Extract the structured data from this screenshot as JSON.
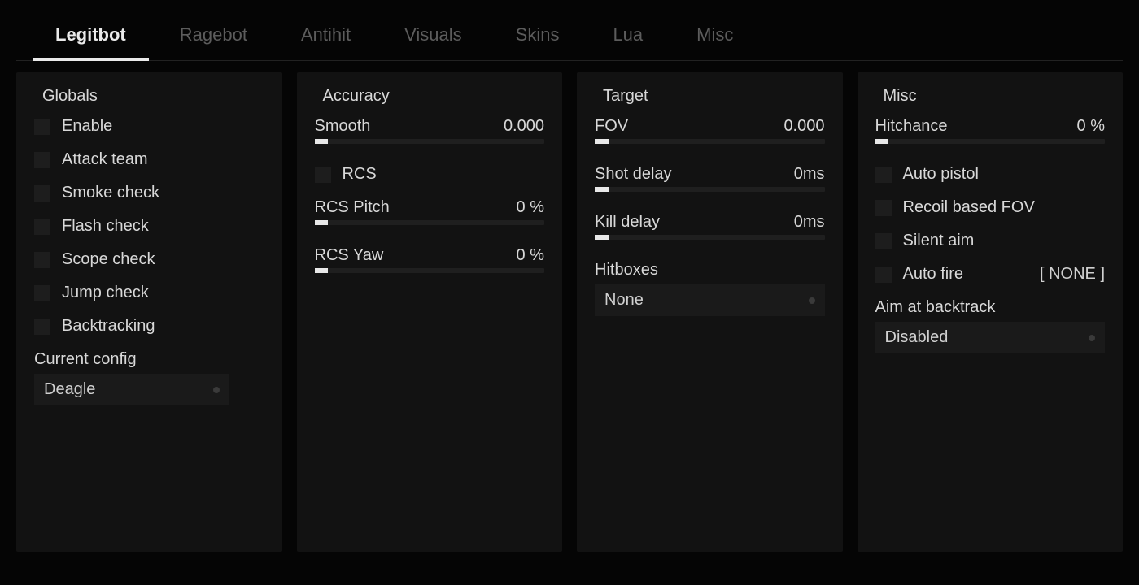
{
  "tabs": [
    {
      "label": "Legitbot",
      "active": true
    },
    {
      "label": "Ragebot",
      "active": false
    },
    {
      "label": "Antihit",
      "active": false
    },
    {
      "label": "Visuals",
      "active": false
    },
    {
      "label": "Skins",
      "active": false
    },
    {
      "label": "Lua",
      "active": false
    },
    {
      "label": "Misc",
      "active": false
    }
  ],
  "globals": {
    "title": "Globals",
    "enable": "Enable",
    "attack_team": "Attack team",
    "smoke_check": "Smoke check",
    "flash_check": "Flash check",
    "scope_check": "Scope check",
    "jump_check": "Jump check",
    "backtracking": "Backtracking",
    "config_label": "Current config",
    "config_value": "Deagle"
  },
  "accuracy": {
    "title": "Accuracy",
    "smooth_label": "Smooth",
    "smooth_value": "0.000",
    "rcs": "RCS",
    "rcs_pitch_label": "RCS Pitch",
    "rcs_pitch_value": "0 %",
    "rcs_yaw_label": "RCS Yaw",
    "rcs_yaw_value": "0 %"
  },
  "target": {
    "title": "Target",
    "fov_label": "FOV",
    "fov_value": "0.000",
    "shot_delay_label": "Shot delay",
    "shot_delay_value": "0ms",
    "kill_delay_label": "Kill delay",
    "kill_delay_value": "0ms",
    "hitboxes_label": "Hitboxes",
    "hitboxes_value": "None"
  },
  "misc": {
    "title": "Misc",
    "hitchance_label": "Hitchance",
    "hitchance_value": "0 %",
    "auto_pistol": "Auto pistol",
    "recoil_fov": "Recoil based FOV",
    "silent_aim": "Silent aim",
    "auto_fire": "Auto fire",
    "auto_fire_bind": "[ NONE ]",
    "aim_backtrack_label": "Aim at backtrack",
    "aim_backtrack_value": "Disabled"
  }
}
